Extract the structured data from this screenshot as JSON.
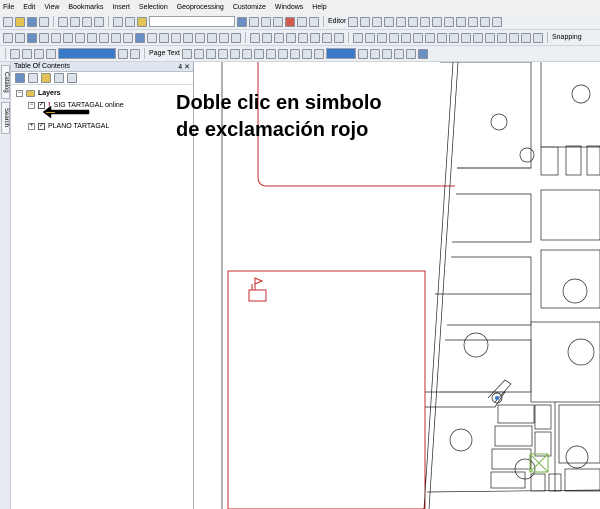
{
  "menu": [
    "File",
    "Edit",
    "View",
    "Bookmarks",
    "Insert",
    "Selection",
    "Geoprocessing",
    "Customize",
    "Windows",
    "Help"
  ],
  "toolbar": {
    "editor_label": "Editor",
    "snapping_label": "Snapping",
    "page_text_label": "Page Text"
  },
  "side_tabs": {
    "catalog": "Catalog",
    "search": "Search"
  },
  "toc": {
    "title": "Table Of Contents",
    "pin_symbol": "4",
    "close_symbol": "✕",
    "layers_label": "Layers",
    "layer_1_label": "SIG TARTAGAL online",
    "layer_2_label": "PLANO TARTAGAL"
  },
  "annotation": {
    "line_1": "Doble clic en simbolo",
    "line_2": "de exclamación rojo"
  },
  "colors": {
    "red_outline": "#c8282a",
    "map_line": "#222222",
    "toolbar_bg": "#eceff4"
  }
}
